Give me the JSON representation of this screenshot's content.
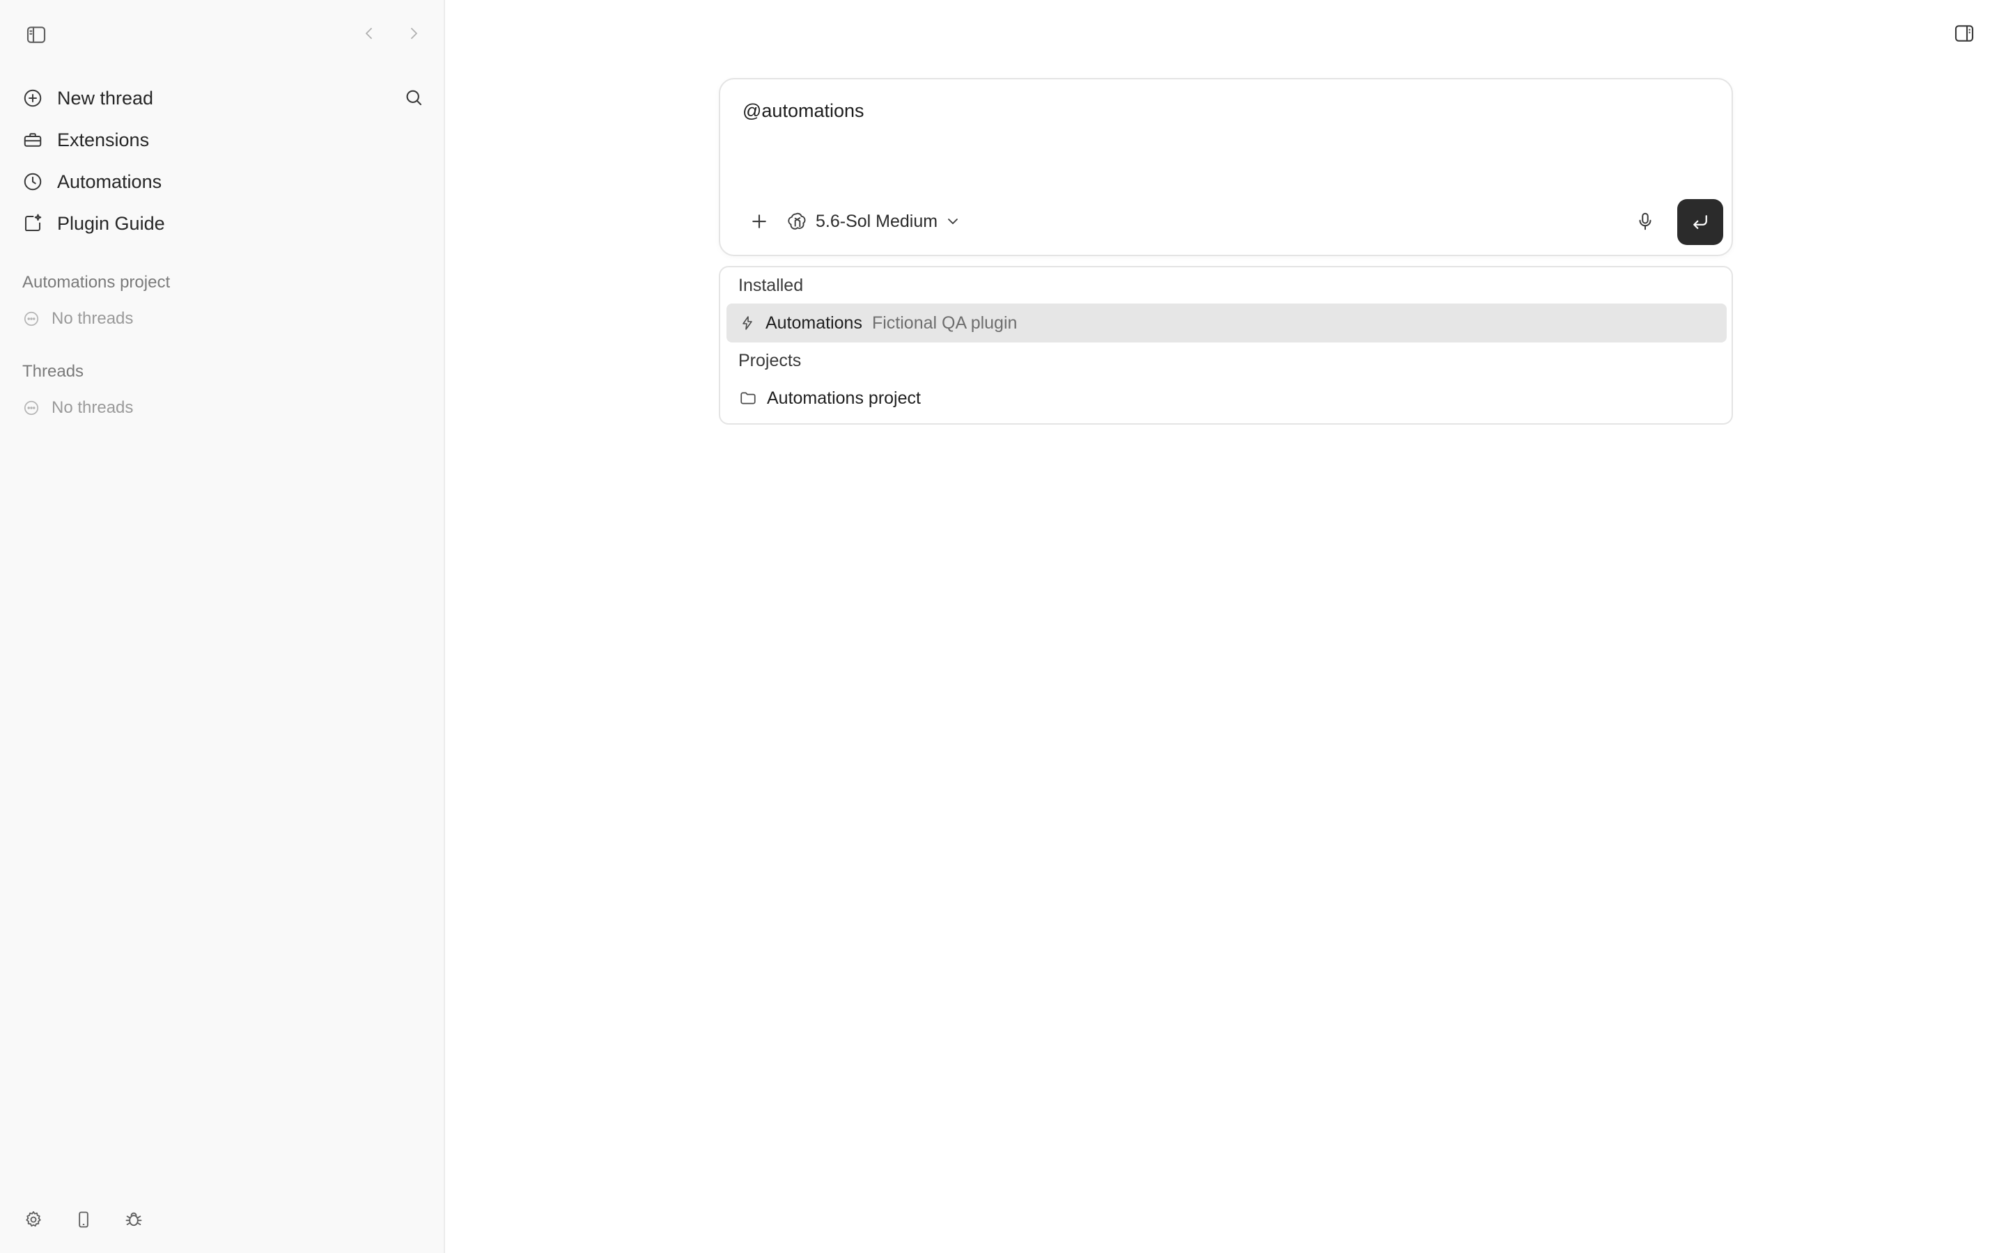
{
  "sidebar": {
    "nav": {
      "new_thread": "New thread",
      "extensions": "Extensions",
      "automations": "Automations",
      "plugin_guide": "Plugin Guide"
    },
    "sections": [
      {
        "title": "Automations project",
        "empty_text": "No threads"
      },
      {
        "title": "Threads",
        "empty_text": "No threads"
      }
    ]
  },
  "composer": {
    "text": "@automations",
    "model": "5.6-Sol Medium"
  },
  "dropdown": {
    "installed_header": "Installed",
    "installed_items": [
      {
        "name": "Automations",
        "description": "Fictional QA plugin"
      }
    ],
    "projects_header": "Projects",
    "project_items": [
      {
        "name": "Automations project"
      }
    ]
  },
  "icons": {
    "toggle_sidebar": "sidebar-toggle-icon",
    "back": "chevron-left-icon",
    "forward": "chevron-right-icon",
    "search": "search-icon",
    "right_panel": "panel-right-icon",
    "settings": "gear-icon",
    "mobile": "phone-icon",
    "debug": "bug-icon"
  },
  "colors": {
    "sidebar_bg": "#f9f9f9",
    "send_button_bg": "#2b2b2b",
    "active_item_bg": "#e6e6e6"
  }
}
